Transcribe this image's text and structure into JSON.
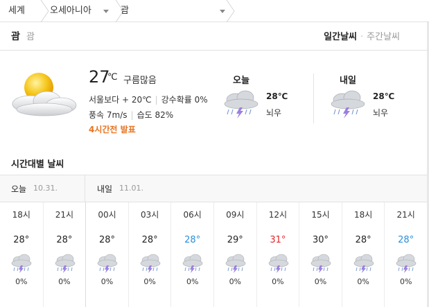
{
  "breadcrumb": {
    "world": "세계",
    "region": "오세아니아",
    "place": "괌"
  },
  "header": {
    "title": "괌",
    "subtitle": "괌",
    "tab_daily": "일간날씨",
    "tab_weekly": "주간날씨"
  },
  "current": {
    "temp": "27",
    "unit": "℃",
    "condition": "구름많음",
    "vs_seoul": "서울보다 + 20℃",
    "precip_prob": "강수확률 0%",
    "wind": "풍속 7m/s",
    "humidity": "습도 82%",
    "announce": "4시간전 발표",
    "icon": "partly-cloudy-sun-icon"
  },
  "forecast": [
    {
      "day": "오늘",
      "temp": "28℃",
      "condition": "뇌우",
      "icon": "thunderstorm-icon"
    },
    {
      "day": "내일",
      "temp": "28℃",
      "condition": "뇌우",
      "icon": "thunderstorm-icon"
    }
  ],
  "hourly_title": "시간대별 날씨",
  "days": [
    {
      "name": "오늘",
      "date": "10.31."
    },
    {
      "name": "내일",
      "date": "11.01."
    }
  ],
  "colors": {
    "normal": "#222222",
    "hot": "#e0262c",
    "cool": "#2a8fd8",
    "announce": "#e8731e"
  },
  "hourly": [
    {
      "time": "18시",
      "temp": "28°",
      "tone": "normal",
      "pop": "0%"
    },
    {
      "time": "21시",
      "temp": "28°",
      "tone": "normal",
      "pop": "0%"
    },
    {
      "time": "00시",
      "temp": "28°",
      "tone": "normal",
      "pop": "0%"
    },
    {
      "time": "03시",
      "temp": "28°",
      "tone": "normal",
      "pop": "0%"
    },
    {
      "time": "06시",
      "temp": "28°",
      "tone": "cool",
      "pop": "0%"
    },
    {
      "time": "09시",
      "temp": "29°",
      "tone": "normal",
      "pop": "0%"
    },
    {
      "time": "12시",
      "temp": "31°",
      "tone": "hot",
      "pop": "0%"
    },
    {
      "time": "15시",
      "temp": "30°",
      "tone": "normal",
      "pop": "0%"
    },
    {
      "time": "18시",
      "temp": "28°",
      "tone": "normal",
      "pop": "0%"
    },
    {
      "time": "21시",
      "temp": "28°",
      "tone": "cool",
      "pop": "0%"
    }
  ]
}
